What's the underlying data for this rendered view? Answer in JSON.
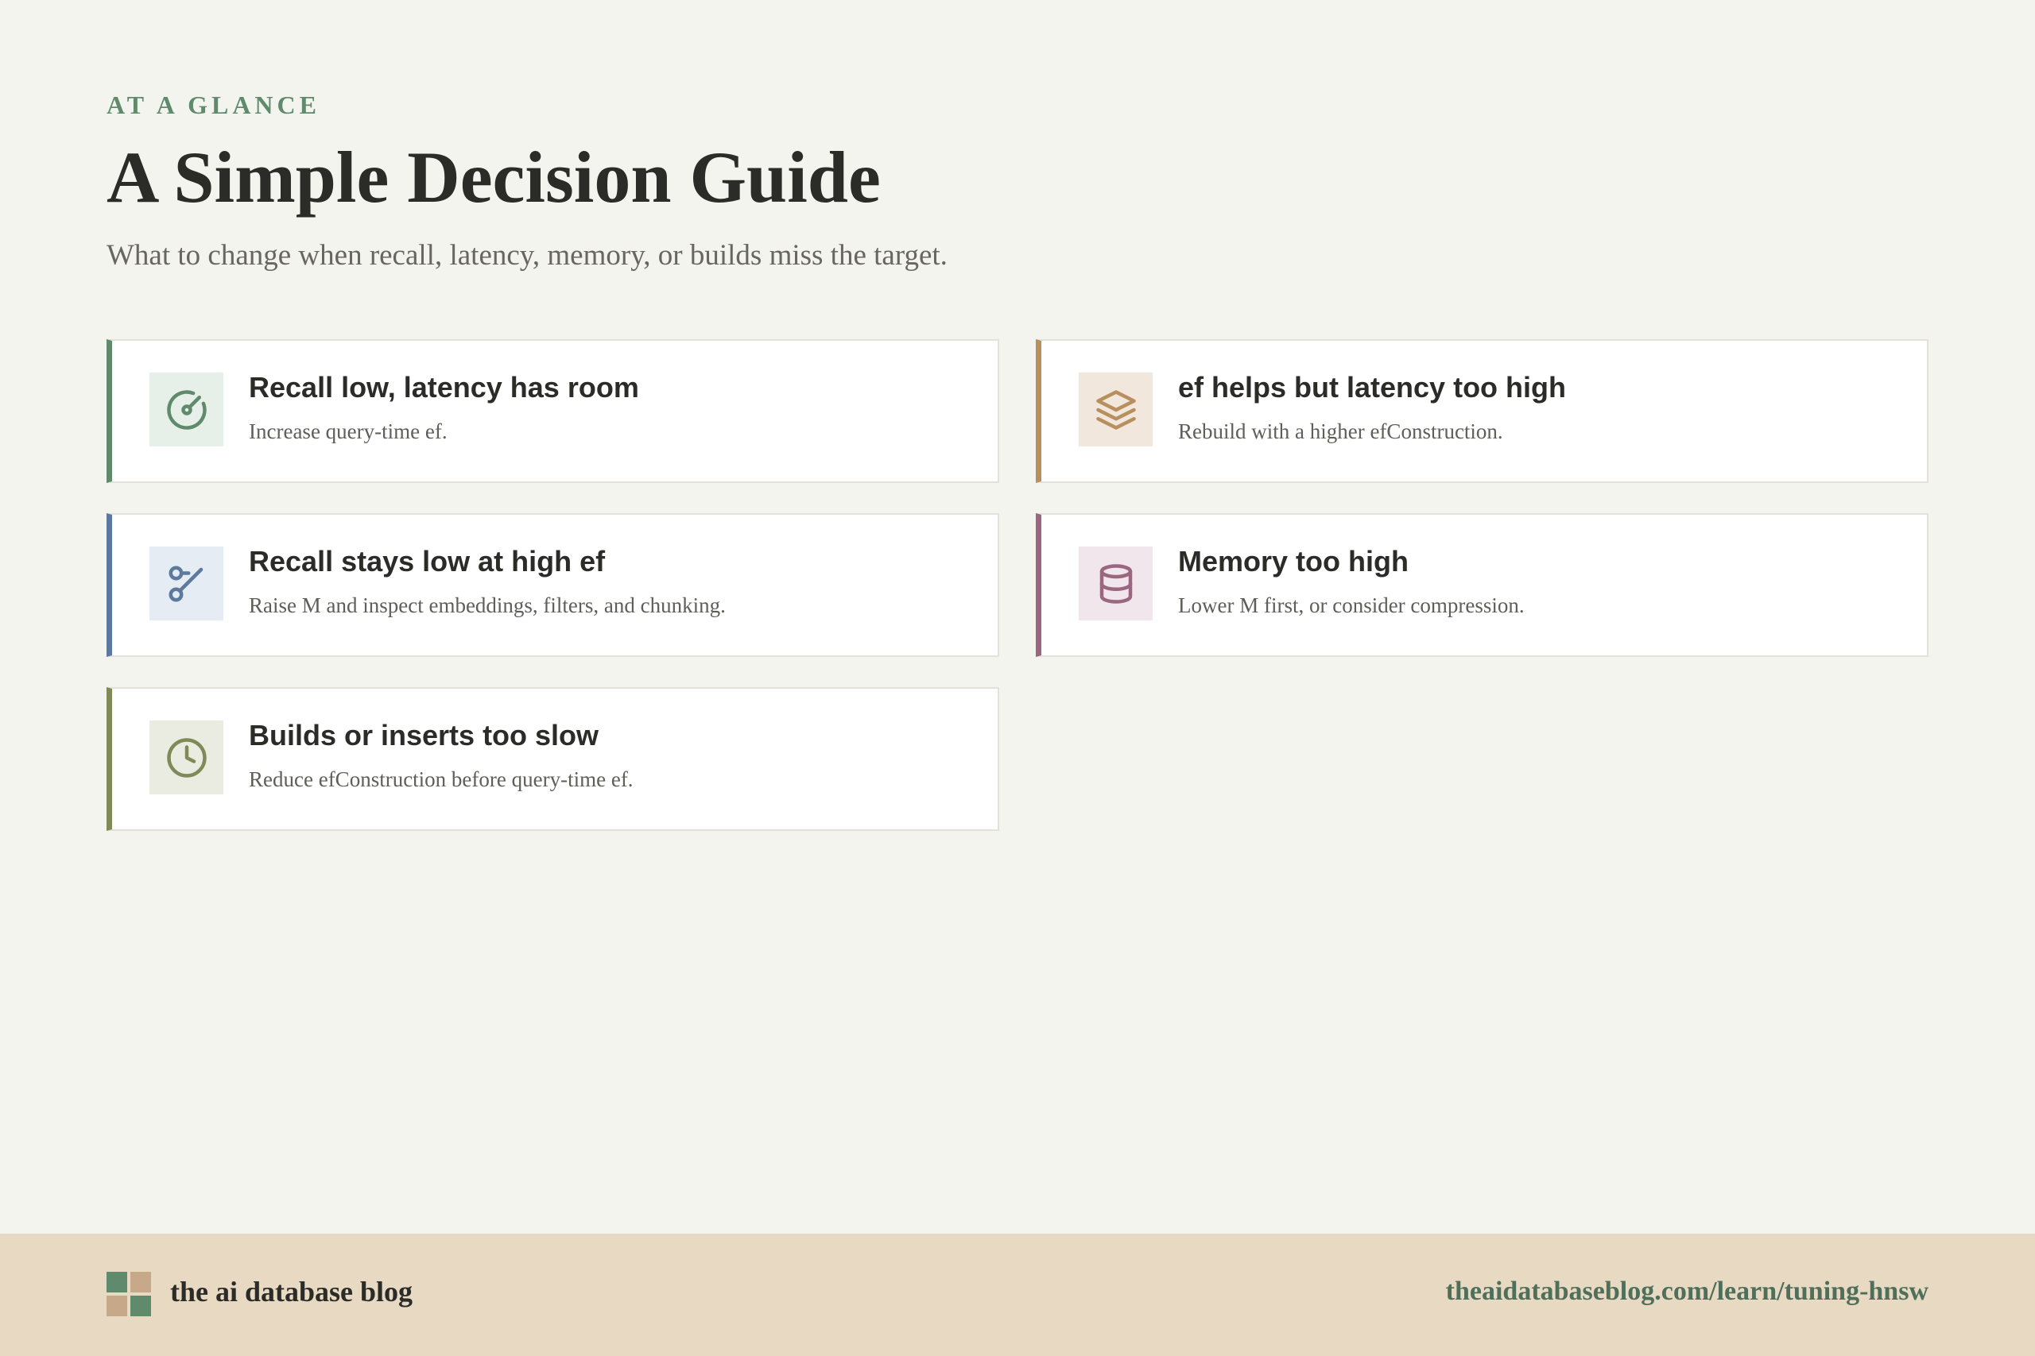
{
  "header": {
    "eyebrow": "AT A GLANCE",
    "title": "A Simple Decision Guide",
    "subtitle": "What to change when recall, latency, memory, or builds miss the target."
  },
  "cards": [
    {
      "title": "Recall low, latency has room",
      "description": "Increase query-time ef.",
      "icon": "gauge-icon",
      "accent": "#5f8a6c",
      "tint": "#e6efe8"
    },
    {
      "title": "ef helps but latency too high",
      "description": "Rebuild with a higher efConstruction.",
      "icon": "layers-icon",
      "accent": "#b88f5e",
      "tint": "#f1e7dc"
    },
    {
      "title": "Recall stays low at high ef",
      "description": "Raise M and inspect embeddings, filters, and chunking.",
      "icon": "git-branch-icon",
      "accent": "#5d7a9e",
      "tint": "#e6ecf3"
    },
    {
      "title": "Memory too high",
      "description": "Lower M first, or consider compression.",
      "icon": "database-icon",
      "accent": "#9b6680",
      "tint": "#f1e6ec"
    },
    {
      "title": "Builds or inserts too slow",
      "description": "Reduce efConstruction before query-time ef.",
      "icon": "clock-icon",
      "accent": "#7f8a58",
      "tint": "#ebece1"
    }
  ],
  "footer": {
    "brand": "the ai database blog",
    "url": "theaidatabaseblog.com/learn/tuning-hnsw",
    "logo_colors": [
      "#5f8a6c",
      "#c7a888",
      "#c7a888",
      "#5f8a6c"
    ]
  }
}
